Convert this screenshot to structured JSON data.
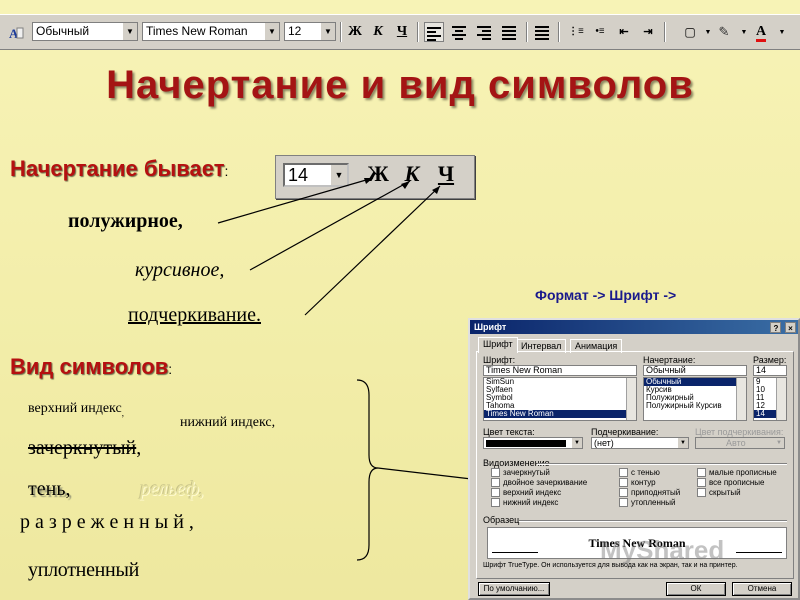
{
  "toolbar": {
    "style_value": "Обычный",
    "font_value": "Times New Roman",
    "size_value": "12",
    "bold_label": "Ж",
    "italic_label": "К",
    "underline_label": "Ч",
    "font_color_label": "A"
  },
  "slide": {
    "title": "Начертание и вид символов",
    "styles_heading": "Начертание бывает",
    "styles_colon": ":",
    "bold_text": "полужирное,",
    "italic_text": "курсивное,",
    "underline_text": "подчеркивание.",
    "kinds_heading": "Вид символов",
    "kinds_colon": ":",
    "superscript_text": "верхний индекс",
    "superscript_dot": ",",
    "subscript_text": "нижний индекс,",
    "strike_text": "зачеркнутый",
    "strike_comma": ",",
    "shadow_text": "тень,",
    "emboss_text": "рельеф,",
    "spaced_text": "р а з р е ж е н н ы й ,",
    "condensed_text": "уплотненный",
    "menu_path": "Формат -> Шрифт ->"
  },
  "mini_toolbar": {
    "size_value": "14",
    "bold_label": "Ж",
    "italic_label": "К",
    "underline_label": "Ч"
  },
  "dialog": {
    "title": "Шрифт",
    "help_btn": "?",
    "close_btn": "×",
    "tabs": [
      "Шрифт",
      "Интервал",
      "Анимация"
    ],
    "font_label": "Шрифт:",
    "font_value": "Times New Roman",
    "font_list": [
      "SimSun",
      "Sylfaen",
      "Symbol",
      "Tahoma",
      "Times New Roman"
    ],
    "style_label": "Начертание:",
    "style_value": "Обычный",
    "style_list": [
      "Обычный",
      "Курсив",
      "Полужирный",
      "Полужирный Курсив"
    ],
    "size_label": "Размер:",
    "size_value": "14",
    "size_list": [
      "9",
      "10",
      "11",
      "12",
      "14"
    ],
    "color_label": "Цвет текста:",
    "underline_label": "Подчеркивание:",
    "underline_value": "(нет)",
    "underline_color_label": "Цвет подчеркивания:",
    "underline_color_value": "Авто",
    "effects_label": "Видоизменение",
    "effects_col1": [
      "зачеркнутый",
      "двойное зачеркивание",
      "верхний индекс",
      "нижний индекс"
    ],
    "effects_col2": [
      "с тенью",
      "контур",
      "приподнятый",
      "утопленный"
    ],
    "effects_col3": [
      "малые прописные",
      "все прописные",
      "скрытый"
    ],
    "preview_label": "Образец",
    "preview_text": "Times New Roman",
    "footer_text": "Шрифт TrueType. Он используется для вывода как на экран, так и на принтер.",
    "default_btn": "По умолчанию...",
    "ok_btn": "ОК",
    "cancel_btn": "Отмена"
  },
  "watermark": "MyShared"
}
